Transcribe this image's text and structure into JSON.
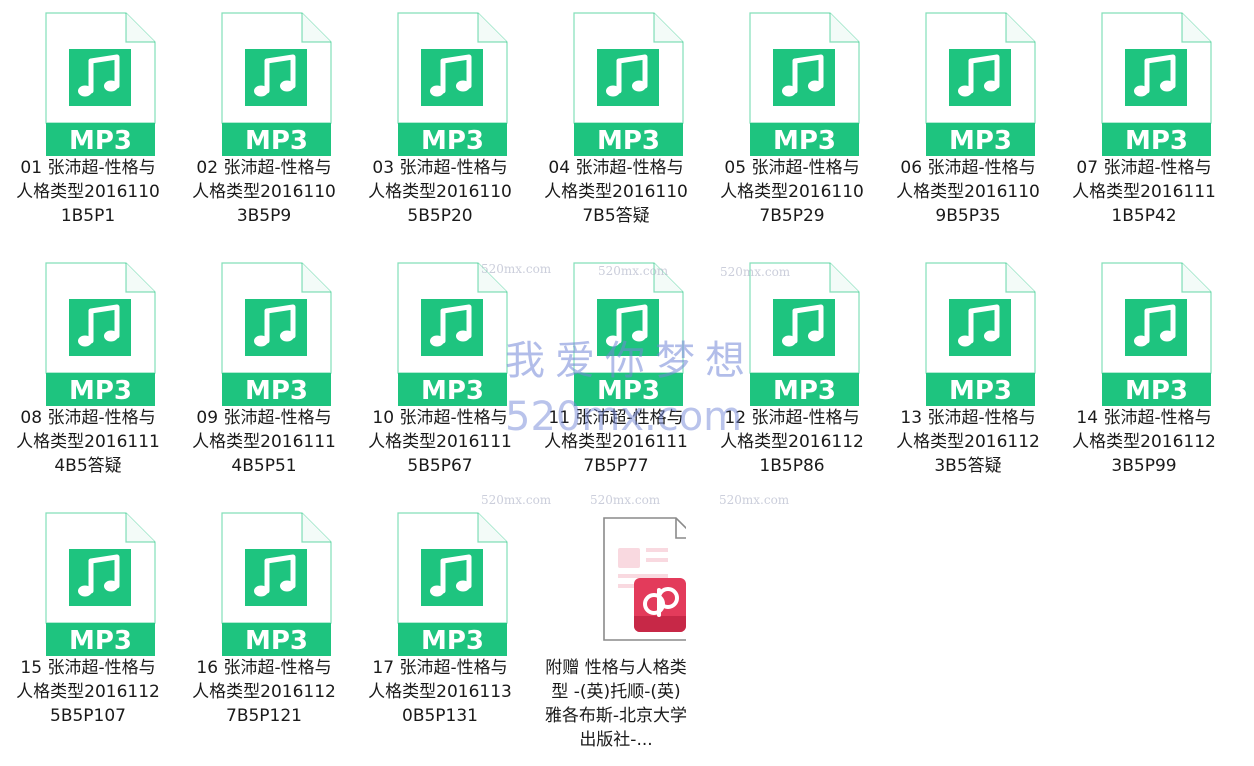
{
  "colors": {
    "mp3_green": "#1ec47f",
    "doc_red": "#e33b5b",
    "watermark": "#7387d7"
  },
  "icons": {
    "audio": "mp3-file-icon",
    "document": "wps-pdf-file-icon"
  },
  "audio_badge": "MP3",
  "files": [
    {
      "name": "01 张沛超-性格与人格类型20161101B5P1",
      "type": "mp3"
    },
    {
      "name": "02 张沛超-性格与人格类型20161103B5P9",
      "type": "mp3"
    },
    {
      "name": "03 张沛超-性格与人格类型20161105B5P20",
      "type": "mp3"
    },
    {
      "name": "04 张沛超-性格与人格类型20161107B5答疑",
      "type": "mp3"
    },
    {
      "name": "05 张沛超-性格与人格类型20161107B5P29",
      "type": "mp3"
    },
    {
      "name": "06 张沛超-性格与人格类型20161109B5P35",
      "type": "mp3"
    },
    {
      "name": "07 张沛超-性格与人格类型20161111B5P42",
      "type": "mp3"
    },
    {
      "name": "08 张沛超-性格与人格类型20161114B5答疑",
      "type": "mp3"
    },
    {
      "name": "09 张沛超-性格与人格类型20161114B5P51",
      "type": "mp3"
    },
    {
      "name": "10 张沛超-性格与人格类型20161115B5P67",
      "type": "mp3"
    },
    {
      "name": "11 张沛超-性格与人格类型20161117B5P77",
      "type": "mp3"
    },
    {
      "name": "12 张沛超-性格与人格类型20161121B5P86",
      "type": "mp3"
    },
    {
      "name": "13 张沛超-性格与人格类型20161123B5答疑",
      "type": "mp3"
    },
    {
      "name": "14 张沛超-性格与人格类型20161123B5P99",
      "type": "mp3"
    },
    {
      "name": "15 张沛超-性格与人格类型20161125B5P107",
      "type": "mp3"
    },
    {
      "name": "16 张沛超-性格与人格类型20161127B5P121",
      "type": "mp3"
    },
    {
      "name": "17 张沛超-性格与人格类型20161130B5P131",
      "type": "mp3"
    },
    {
      "name": "附赠 性格与人格类型 -(英)托顺-(英)雅各布斯-北京大学出版社-...",
      "type": "doc"
    }
  ],
  "watermark": {
    "main": "我爱你梦想",
    "url": "520mx.com",
    "small": "520mx.com"
  }
}
